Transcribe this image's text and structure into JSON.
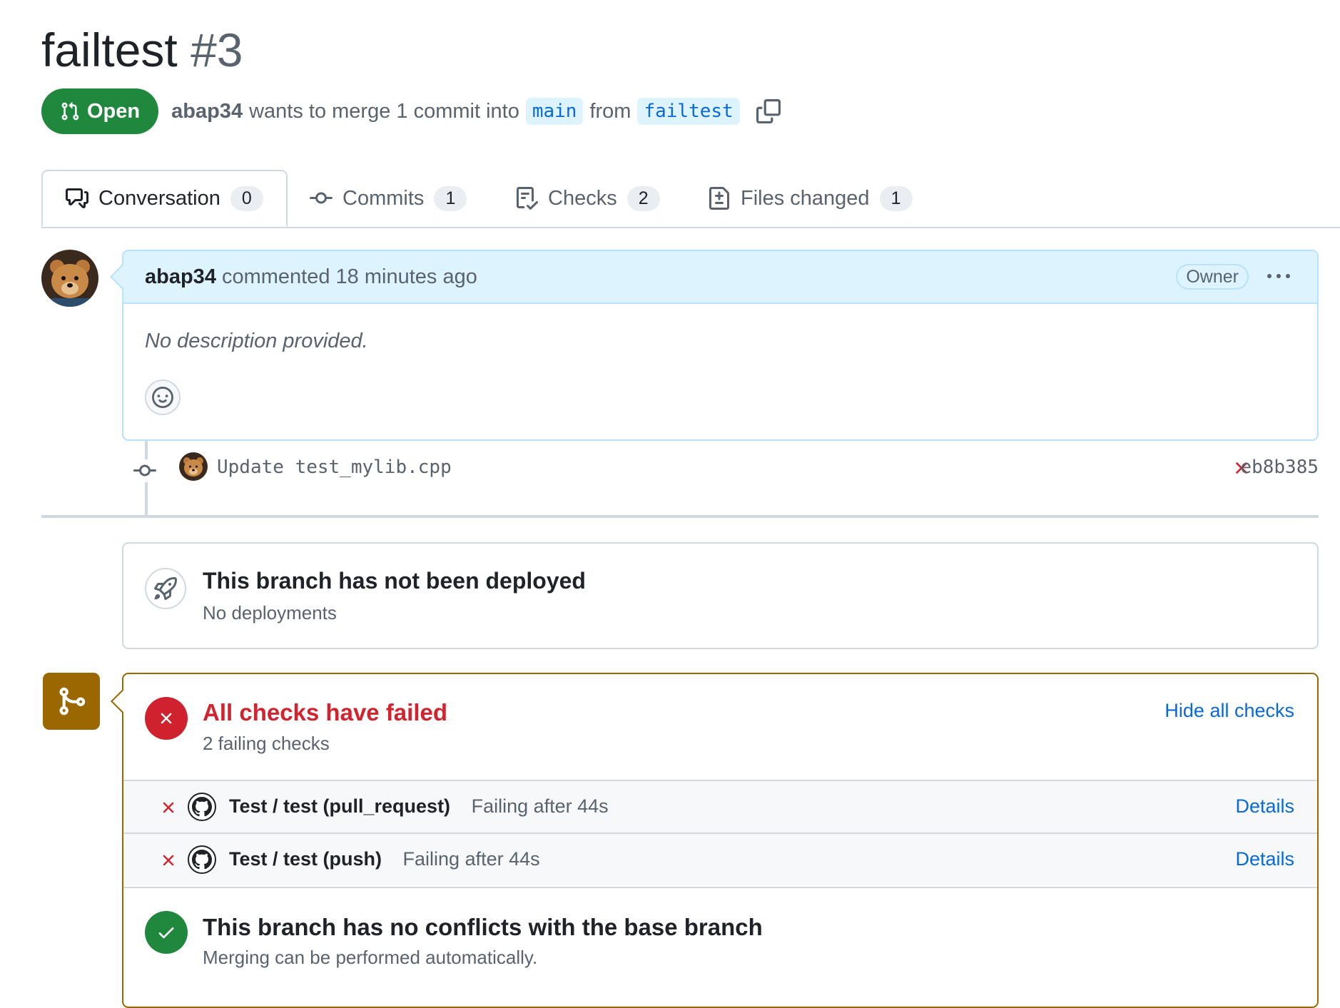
{
  "header": {
    "title": "failtest",
    "number": "#3",
    "state": "Open",
    "author": "abap34",
    "merge_text": "wants to merge 1 commit into",
    "base_branch": "main",
    "from_text": "from",
    "head_branch": "failtest"
  },
  "tabs": [
    {
      "label": "Conversation",
      "count": "0"
    },
    {
      "label": "Commits",
      "count": "1"
    },
    {
      "label": "Checks",
      "count": "2"
    },
    {
      "label": "Files changed",
      "count": "1"
    }
  ],
  "comment": {
    "author": "abap34",
    "action": "commented 18 minutes ago",
    "role": "Owner",
    "body": "No description provided."
  },
  "commit": {
    "message": "Update test_mylib.cpp",
    "sha": "eb8b385"
  },
  "deployment": {
    "title": "This branch has not been deployed",
    "subtitle": "No deployments"
  },
  "checks": {
    "title": "All checks have failed",
    "subtitle": "2 failing checks",
    "toggle": "Hide all checks",
    "items": [
      {
        "name": "Test / test (pull_request)",
        "status": "Failing after 44s",
        "link": "Details"
      },
      {
        "name": "Test / test (push)",
        "status": "Failing after 44s",
        "link": "Details"
      }
    ]
  },
  "conflicts": {
    "title": "This branch has no conflicts with the base branch",
    "subtitle": "Merging can be performed automatically."
  },
  "colors": {
    "open_green": "#1f883d",
    "fail_red": "#cf222e",
    "link_blue": "#0969da",
    "merge_brown": "#9a6700"
  }
}
